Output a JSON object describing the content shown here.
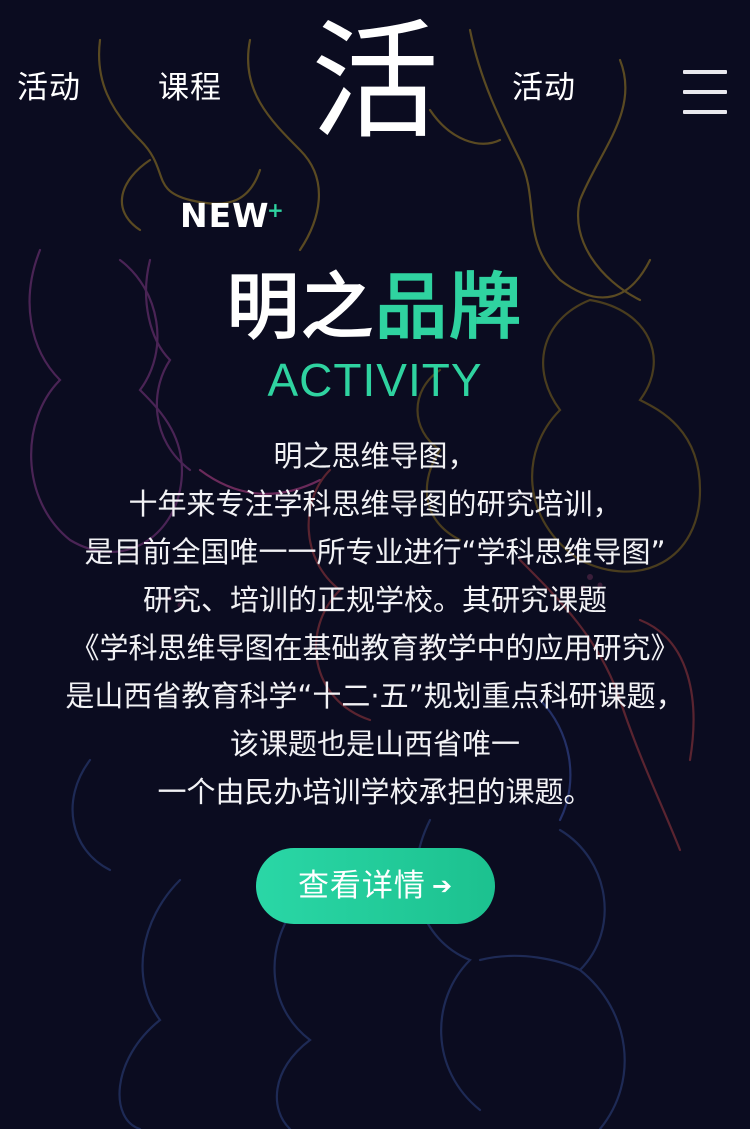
{
  "header": {
    "nav_left": [
      "活动",
      "课程"
    ],
    "logo_char": "活",
    "nav_right": [
      "活动"
    ],
    "menu_icon": "hamburger-menu-icon"
  },
  "hero": {
    "badge": "NEW",
    "badge_mark": "+",
    "title_white": "明之",
    "title_green": "品牌",
    "subtitle": "ACTIVITY",
    "description": [
      "明之思维导图，",
      "十年来专注学科思维导图的研究培训，",
      "是目前全国唯一一所专业进行“学科思维导图”",
      "研究、培训的正规学校。其研究课题",
      "《学科思维导图在基础教育教学中的应用研究》",
      "是山西省教育科学“十二·五”规划重点科研课题，",
      "该课题也是山西省唯一",
      "一个由民办培训学校承担的课题。"
    ],
    "cta_label": "查看详情",
    "cta_icon": "arrow-right-icon"
  },
  "colors": {
    "background": "#0b0c20",
    "accent": "#2fd3a0",
    "text": "#ffffff"
  }
}
